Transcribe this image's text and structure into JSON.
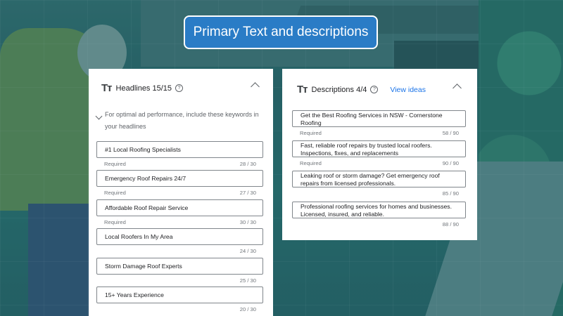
{
  "title": "Primary Text and descriptions",
  "icons": {
    "text_icon": "text-format-icon",
    "help_icon": "help-circle-icon",
    "collapse_icon": "chevron-up-icon",
    "expand_icon": "chevron-down-icon"
  },
  "colors": {
    "accent": "#2a7cc6",
    "link": "#1a73e8"
  },
  "headlines": {
    "title": "Headlines 15/15",
    "icon_glyph": "Tт",
    "help_glyph": "?",
    "hint": "For optimal ad performance, include these keywords in your headlines",
    "items": [
      {
        "text": "#1 Local Roofing Specialists",
        "required": "Required",
        "count": "28 / 30"
      },
      {
        "text": "Emergency Roof Repairs 24/7",
        "required": "Required",
        "count": "27 / 30"
      },
      {
        "text": "Affordable Roof Repair Service",
        "required": "Required",
        "count": "30 / 30"
      },
      {
        "text": "Local Roofers In My Area",
        "required": "",
        "count": "24 / 30"
      },
      {
        "text": "Storm Damage Roof Experts",
        "required": "",
        "count": "25 / 30"
      },
      {
        "text": "15+ Years Experience",
        "required": "",
        "count": "20 / 30"
      }
    ]
  },
  "descriptions": {
    "title": "Descriptions 4/4",
    "icon_glyph": "Tт",
    "help_glyph": "?",
    "view_ideas": "View ideas",
    "items": [
      {
        "text": "Get the Best Roofing Services in NSW - Cornerstone Roofing",
        "required": "Required",
        "count": "58 / 90"
      },
      {
        "text": "Fast, reliable roof repairs by trusted local roofers. Inspections, fixes, and replacements",
        "required": "Required",
        "count": "90 / 90"
      },
      {
        "text": "Leaking roof or storm damage? Get emergency roof repairs from licensed professionals.",
        "required": "",
        "count": "85 / 90"
      },
      {
        "text": "Professional roofing services for homes and businesses. Licensed, insured, and reliable.",
        "required": "",
        "count": "88 / 90"
      }
    ]
  }
}
